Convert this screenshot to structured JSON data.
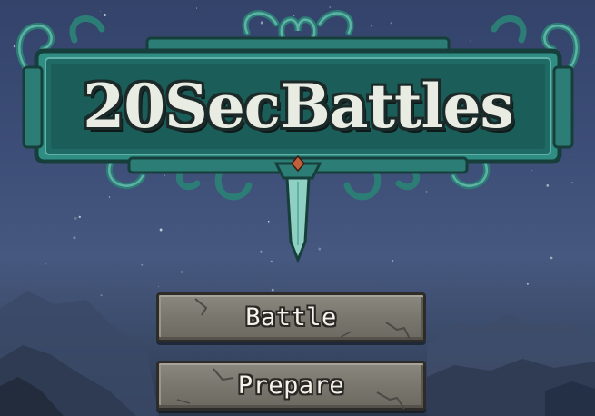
{
  "game": {
    "title": "20SecBattles"
  },
  "menu": {
    "battle_label": "Battle",
    "prepare_label": "Prepare"
  },
  "colors": {
    "sky_top": "#33436a",
    "sky_bottom": "#2c374d",
    "frame_teal": "#2c7d76",
    "frame_highlight": "#5fb3a6",
    "title_text": "#e9ece2",
    "button_stone": "#7b786f",
    "button_border": "#2e2c29",
    "gem": "#c2603e"
  }
}
